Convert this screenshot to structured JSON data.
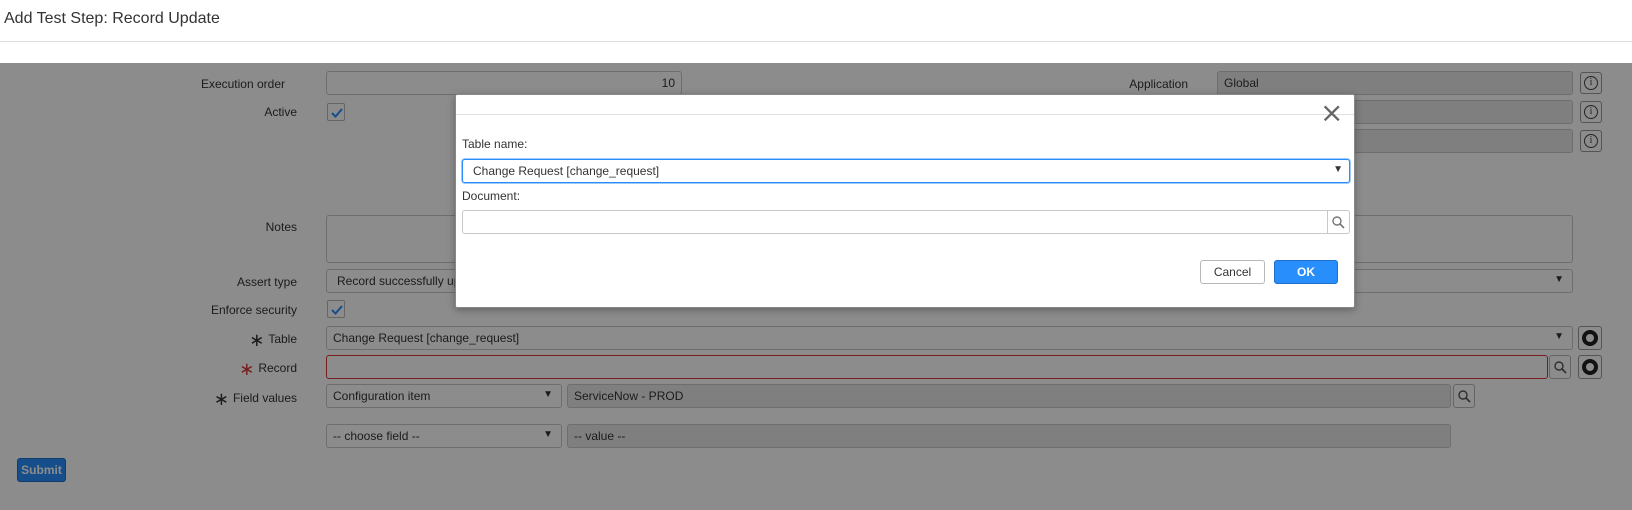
{
  "page": {
    "title": "Add Test Step: Record Update"
  },
  "form": {
    "execution_order": {
      "label": "Execution order",
      "value": "10"
    },
    "application": {
      "label": "Application",
      "value": "Global"
    },
    "active": {
      "label": "Active",
      "checked": true
    },
    "notes": {
      "label": "Notes",
      "value": ""
    },
    "assert_type": {
      "label": "Assert type",
      "value": "Record successfully upd"
    },
    "enforce_security": {
      "label": "Enforce security",
      "checked": true
    },
    "table": {
      "label": "Table",
      "required_marker": "∗",
      "value": "Change Request [change_request]"
    },
    "record": {
      "label": "Record",
      "required_marker": "∗",
      "value": ""
    },
    "field_values": {
      "label": "Field values",
      "required_marker": "∗",
      "rows": [
        {
          "field": "Configuration item",
          "value": "ServiceNow - PROD"
        },
        {
          "field": "-- choose field --",
          "value": "-- value --"
        }
      ]
    },
    "submit_label": "Submit"
  },
  "modal": {
    "table_name_label": "Table name:",
    "table_name_value": "Change Request [change_request]",
    "document_label": "Document:",
    "document_value": "",
    "cancel_label": "Cancel",
    "ok_label": "OK",
    "close_glyph": "×"
  },
  "colors": {
    "primary_button": "#278efc",
    "required_star_error": "#d93838",
    "overlay": "rgba(0,0,0,0.45)"
  },
  "icons": {
    "close": "close-icon",
    "search": "search-icon",
    "info": "info-icon",
    "dependency": "dependency-icon",
    "checkmark": "checkmark-icon",
    "dropdown": "chevron-down-icon"
  }
}
